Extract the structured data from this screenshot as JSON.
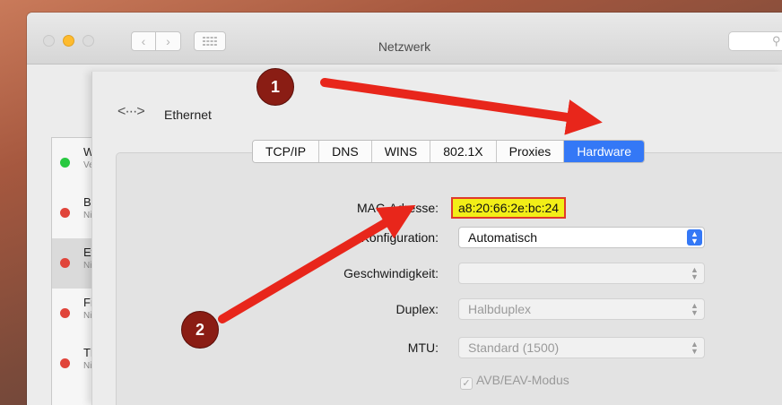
{
  "window": {
    "title": "Netzwerk",
    "nav": {
      "back_icon": "chevron-left-icon",
      "forward_icon": "chevron-right-icon",
      "grid_icon": "grid-icon"
    },
    "search_icon": "search-icon"
  },
  "sidebar": {
    "items": [
      {
        "name": "W",
        "status": "Ve",
        "dot_color": "#28c840"
      },
      {
        "name": "Bl",
        "status": "Ni",
        "dot_color": "#e0443a"
      },
      {
        "name": "Et",
        "status": "Ni",
        "dot_color": "#e0443a",
        "selected": true
      },
      {
        "name": "Fi",
        "status": "Ni",
        "dot_color": "#e0443a"
      },
      {
        "name": "Th",
        "status": "Ni",
        "dot_color": "#e0443a"
      }
    ]
  },
  "sheet": {
    "icon": "ethernet-icon",
    "icon_glyph": "<···>",
    "title": "Ethernet",
    "tabs": [
      "TCP/IP",
      "DNS",
      "WINS",
      "802.1X",
      "Proxies",
      "Hardware"
    ],
    "active_tab": "Hardware",
    "fields": {
      "mac_label": "MAC-Adresse:",
      "mac_value": "a8:20:66:2e:bc:24",
      "config_label": "Konfiguration:",
      "config_value": "Automatisch",
      "speed_label": "Geschwindigkeit:",
      "speed_value": "",
      "duplex_label": "Duplex:",
      "duplex_value": "Halbduplex",
      "mtu_label": "MTU:",
      "mtu_value": "Standard (1500)",
      "avb_label": "AVB/EAV-Modus",
      "avb_checked": true
    }
  },
  "annotations": {
    "badge1": "1",
    "badge2": "2",
    "arrow_color": "#e8261b",
    "badge_color": "#8a1d14"
  }
}
